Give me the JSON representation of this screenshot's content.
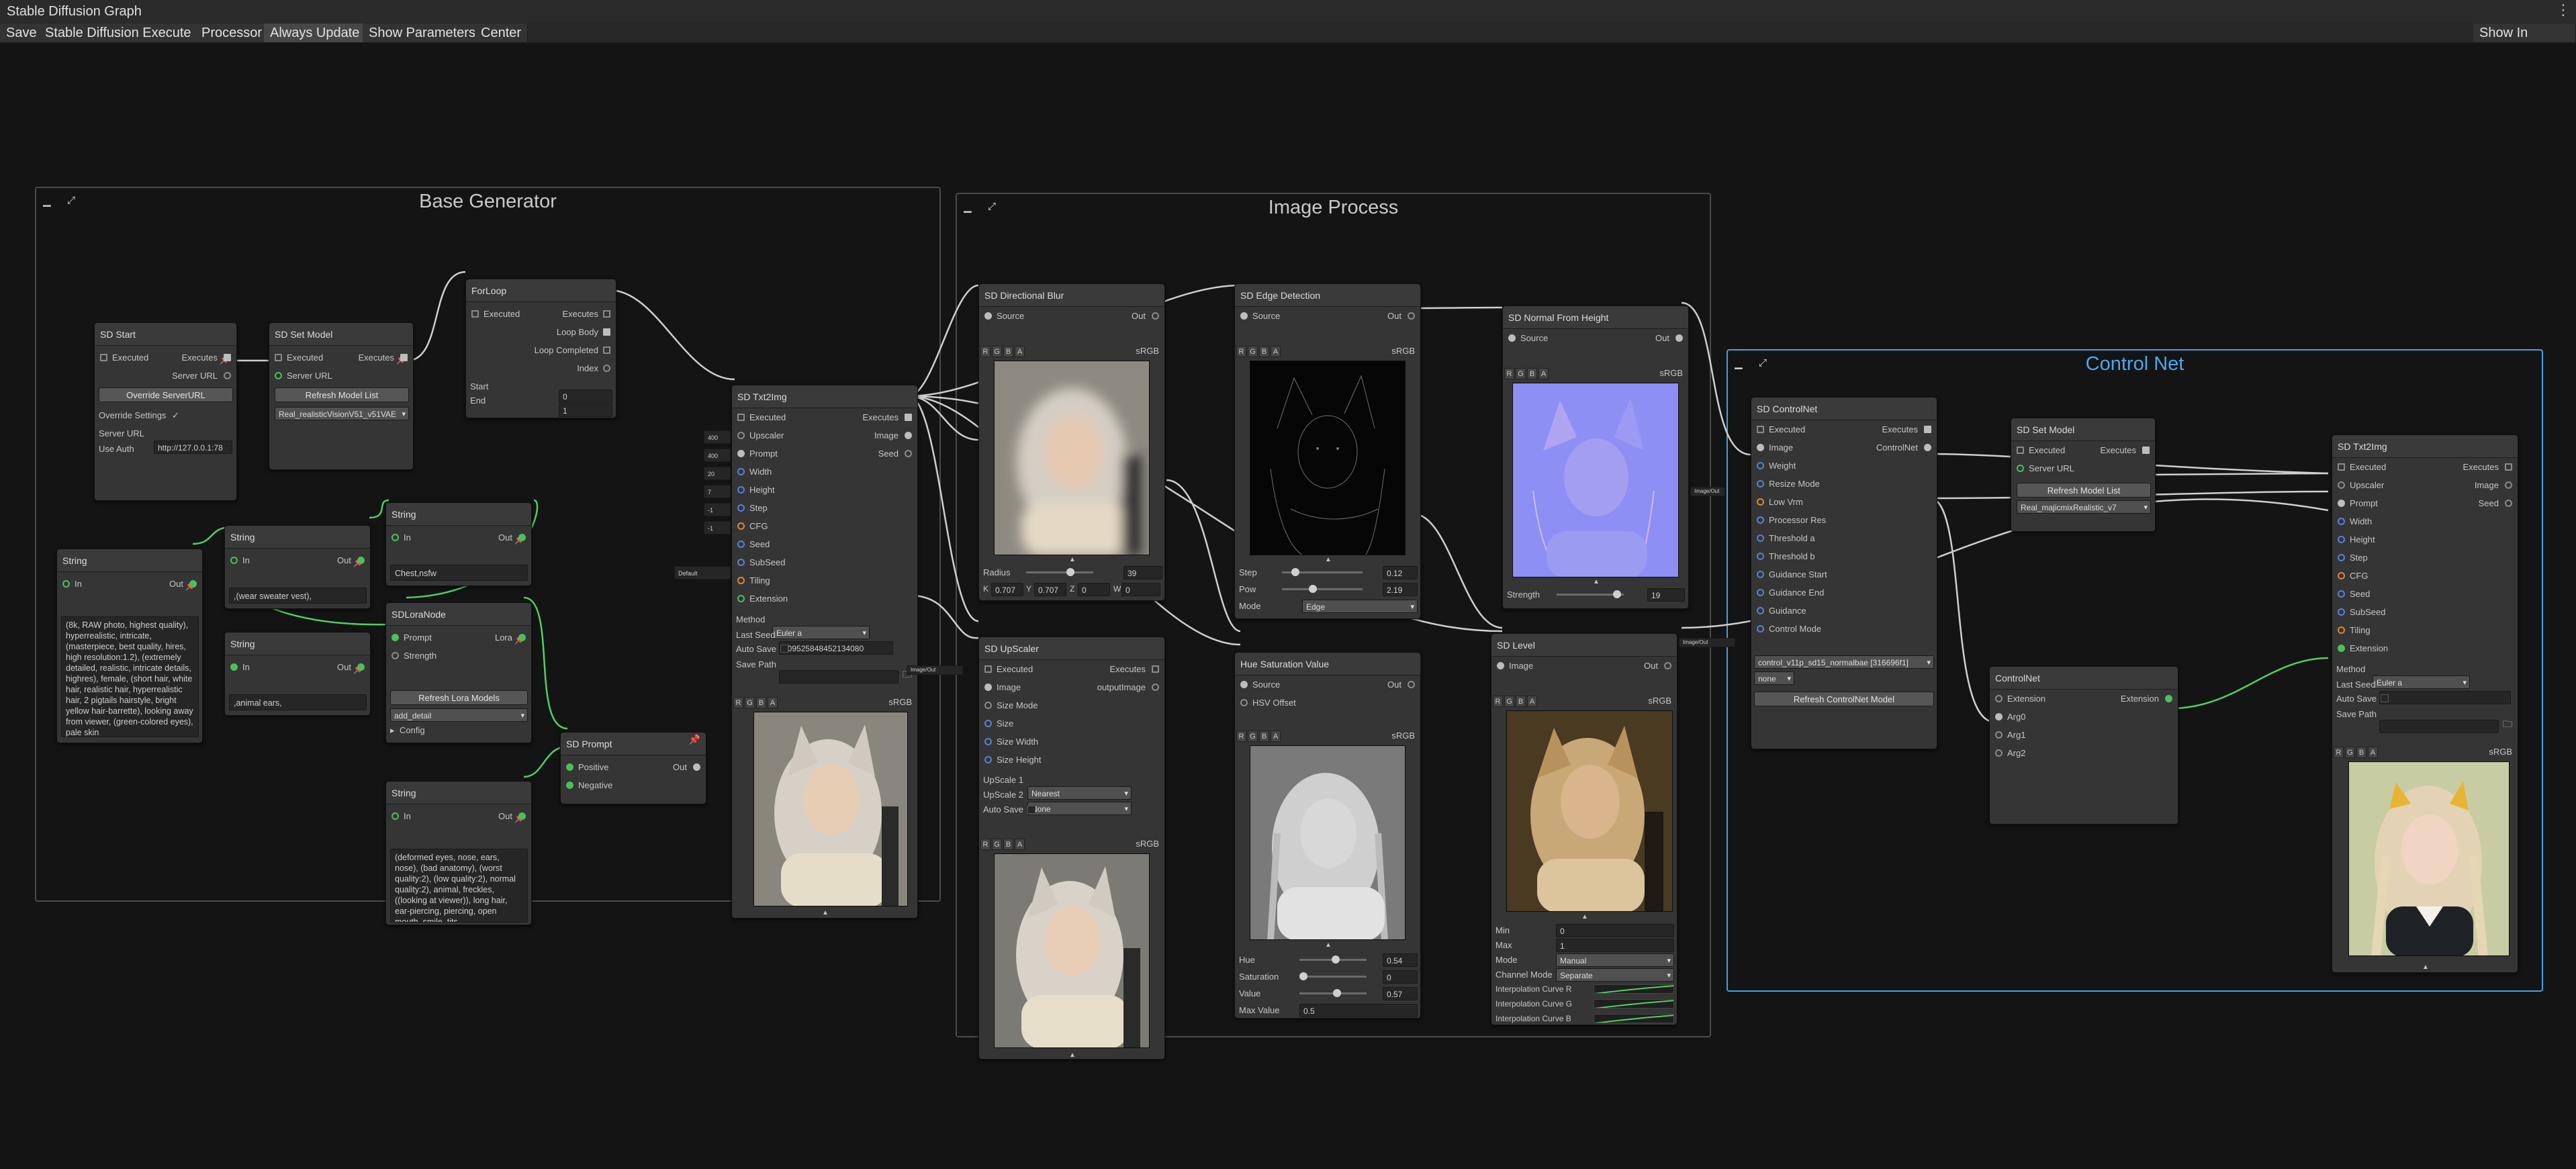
{
  "window": {
    "title": "Stable Diffusion Graph"
  },
  "toolbar": {
    "save": "Save",
    "execute": "Stable Diffusion Execute",
    "processor": "Processor",
    "always_update": "Always Update",
    "show_parameters": "Show Parameters",
    "center": "Center",
    "show_in_project": "Show In Project"
  },
  "groups": {
    "base": "Base Generator",
    "image": "Image Process",
    "control": "Control Net"
  },
  "common": {
    "executed": "Executed",
    "executes": "Executes",
    "server_url": "Server URL",
    "in": "In",
    "out": "Out",
    "image": "Image",
    "source": "Source",
    "srgb": "sRGB",
    "ch_r": "R",
    "ch_g": "G",
    "ch_b": "B",
    "ch_a": "A"
  },
  "sd_start": {
    "title": "SD Start",
    "override_btn": "Override ServerURL",
    "override_settings": "Override Settings",
    "check": "✓",
    "server_url_value": "http://127.0.0.1:78",
    "use_auth": "Use Auth"
  },
  "sd_set_model": {
    "title": "SD Set Model",
    "refresh": "Refresh Model List",
    "model": "Real_realisticVisionV51_v51VAE"
  },
  "forloop": {
    "title": "ForLoop",
    "loop_body": "Loop Body",
    "loop_completed": "Loop Completed",
    "index": "Index",
    "start": "Start",
    "start_val": "0",
    "end": "End",
    "end_val": "1"
  },
  "string1": {
    "title": "String",
    "text": "(8k, RAW photo, highest quality), hyperrealistic, intricate, (masterpiece, best quality, hires, high resolution:1.2), (extremely detailed, realistic, intricate details, highres), female, (short hair, white hair, realistic hair, hyperrealistic hair, 2 pigtails hairstyle, bright yellow hair-barrette), looking away from viewer, (green-colored eyes), pale skin"
  },
  "string2": {
    "title": "String",
    "text": ",(wear sweater vest),"
  },
  "string3": {
    "title": "String",
    "text": ",animal ears,"
  },
  "string4": {
    "title": "String",
    "text": "Chest,nsfw"
  },
  "string5": {
    "title": "String",
    "text": "(deformed eyes, nose, ears, nose), (bad anatomy), (worst quality:2), (low quality:2), normal quality:2), animal, freckles, ((looking at viewer)), long hair, ear-piercing, piercing, open mouth, smile, tits"
  },
  "lora": {
    "title": "SDLoraNode",
    "prompt": "Prompt",
    "lora": "Lora",
    "strength": "Strength",
    "refresh": "Refresh Lora Models",
    "value": "add_detail",
    "config": "Config"
  },
  "sd_prompt": {
    "title": "SD Prompt",
    "positive": "Positive",
    "negative": "Negative"
  },
  "txt2img1": {
    "title": "SD Txt2Img",
    "upscaler": "Upscaler",
    "prompt": "Prompt",
    "width": "Width",
    "height": "Height",
    "step": "Step",
    "cfg": "CFG",
    "seed": "Seed",
    "subseed": "SubSeed",
    "tiling": "Tiling",
    "extension": "Extension",
    "seed_out": "Seed",
    "method": "Method",
    "method_value": "Euler a",
    "last_seed": "Last Seed",
    "last_seed_value": "809525848452134080",
    "auto_save": "Auto Save",
    "save_path": "Save Path",
    "side_labels": [
      "400",
      "400",
      "20",
      "7",
      "-1",
      "-1",
      "Default"
    ]
  },
  "dir_blur": {
    "title": "SD Directional Blur",
    "radius": "Radius",
    "radius_value": "39",
    "k": "K",
    "k_value": "0.707",
    "y": "Y",
    "y_value": "0.707",
    "z": "Z",
    "z_value": "0",
    "w": "W",
    "w_value": "0"
  },
  "edge": {
    "title": "SD Edge Detection",
    "step": "Step",
    "step_value": "0.12",
    "pow": "Pow",
    "pow_value": "2.19",
    "mode": "Mode",
    "mode_value": "Edge"
  },
  "normal": {
    "title": "SD Normal From Height",
    "strength": "Strength",
    "strength_value": "19"
  },
  "upscaler": {
    "title": "SD UpScaler",
    "out_image": "outputImage",
    "size_mode": "Size Mode",
    "size": "Size",
    "size_width": "Size Width",
    "size_height": "Size Height",
    "up1": "UpScale 1",
    "up1_value": "Nearest",
    "up2": "UpScale 2",
    "up2_value": "None",
    "auto_save": "Auto Save"
  },
  "hsv": {
    "title": "Hue Saturation Value",
    "hsv_offset": "HSV Offset",
    "hue": "Hue",
    "hue_value": "0.54",
    "hue_frac": 0.54,
    "saturation": "Saturation",
    "saturation_value": "0",
    "saturation_frac": 0.0,
    "value": "Value",
    "value_value": "0.57",
    "value_frac": 0.57,
    "max_value": "Max Value",
    "max_value_value": "0.5"
  },
  "level": {
    "title": "SD Level",
    "min": "Min",
    "min_value": "0",
    "max": "Max",
    "max_value": "1",
    "mode": "Mode",
    "mode_value": "Manual",
    "channel_mode": "Channel Mode",
    "channel_value": "Separate",
    "curve_r": "Interpolation Curve R",
    "curve_g": "Interpolation Curve G",
    "curve_b": "Interpolation Curve B"
  },
  "controlnet": {
    "title": "SD ControlNet",
    "control_net": "ControlNet",
    "weight": "Weight",
    "resize_mode": "Resize Mode",
    "low_vrm": "Low Vrm",
    "processor_res": "Processor Res",
    "threshold_a": "Threshold a",
    "threshold_b": "Threshold b",
    "guidance_start": "Guidance Start",
    "guidance_end": "Guidance End",
    "guidance": "Guidance",
    "control_mode": "Control Mode",
    "model": "control_v11p_sd15_normalbae [316696f1]",
    "module": "none",
    "refresh": "Refresh ControlNet Model"
  },
  "sd_set_model2": {
    "title": "SD Set Model",
    "refresh": "Refresh Model List",
    "model": "Real_majicmixRealistic_v7"
  },
  "cn_node": {
    "title": "ControlNet",
    "extension": "Extension",
    "arg0": "Arg0",
    "arg1": "Arg1",
    "arg2": "Arg2"
  },
  "txt2img2": {
    "title": "SD Txt2Img",
    "method_value": "Euler a",
    "last_seed_value": "0"
  },
  "wire_tags": {
    "t1": "Image/Out",
    "t2": "Image/Out",
    "t3": "Image/Out"
  }
}
